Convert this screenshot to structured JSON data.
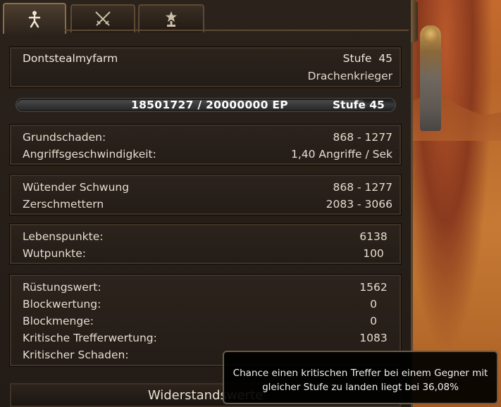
{
  "tabs": [
    {
      "name": "character",
      "icon": "person-icon",
      "active": true
    },
    {
      "name": "combat",
      "icon": "crossed-swords-icon",
      "active": false
    },
    {
      "name": "achievements",
      "icon": "trophy-star-icon",
      "active": false
    }
  ],
  "character": {
    "name": "Dontstealmyfarm",
    "level_label": "Stufe",
    "level": "45",
    "class": "Drachenkrieger"
  },
  "experience": {
    "text": "18501727 / 20000000 EP",
    "current": 18501727,
    "max": 20000000,
    "level_text": "Stufe 45"
  },
  "damage": {
    "base_label": "Grundschaden:",
    "base_value": "868 - 1277",
    "speed_label": "Angriffsgeschwindigkeit:",
    "speed_value": "1,40 Angriffe / Sek"
  },
  "skills": [
    {
      "label": "Wütender Schwung",
      "value": "868 - 1277"
    },
    {
      "label": "Zerschmettern",
      "value": "2083 - 3066"
    }
  ],
  "resources": [
    {
      "label": "Lebenspunkte:",
      "value": "6138"
    },
    {
      "label": "Wutpunkte:",
      "value": "100"
    }
  ],
  "defense": [
    {
      "label": "Rüstungswert:",
      "value": "1562"
    },
    {
      "label": "Blockwertung:",
      "value": "0"
    },
    {
      "label": "Blockmenge:",
      "value": "0"
    },
    {
      "label": "Kritische Trefferwertung:",
      "value": "1083"
    },
    {
      "label": "Kritischer Schaden:",
      "value": "",
      "note": "value obscured by tooltip"
    }
  ],
  "bottom_button": "Widerstandswerte",
  "tooltip": "Chance einen kritischen Treffer bei einem Gegner mit gleicher Stufe zu landen liegt bei 36,08%",
  "colors": {
    "panel_bg": "#231c16",
    "border": "#5e4a34",
    "text": "#e6ddd0",
    "world": "#c46a2e"
  }
}
